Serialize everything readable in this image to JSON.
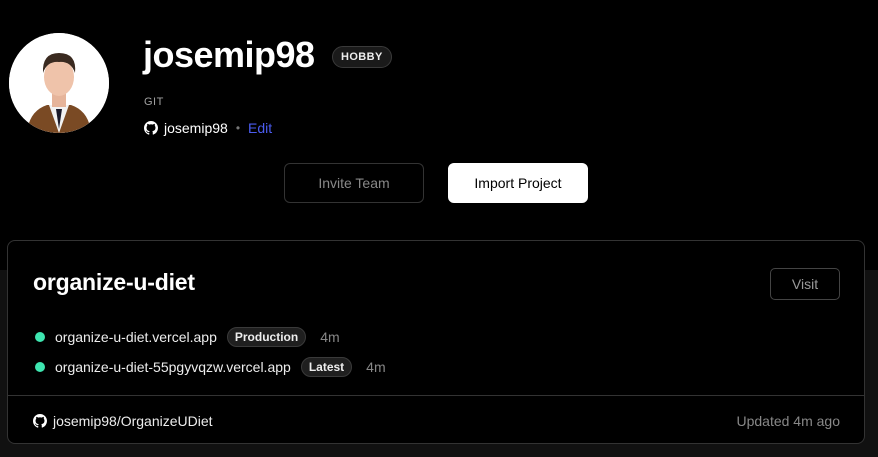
{
  "profile": {
    "username": "josemip98",
    "plan_badge": "HOBBY",
    "git_label": "GIT",
    "git_username": "josemip98",
    "separator": "•",
    "edit_label": "Edit"
  },
  "actions": {
    "invite_label": "Invite Team",
    "import_label": "Import Project"
  },
  "project": {
    "name": "organize-u-diet",
    "visit_label": "Visit",
    "deployments": [
      {
        "url": "organize-u-diet.vercel.app",
        "badge": "Production",
        "age": "4m",
        "status_color": "#3ee6b0"
      },
      {
        "url": "organize-u-diet-55pgyvqzw.vercel.app",
        "badge": "Latest",
        "age": "4m",
        "status_color": "#3ee6b0"
      }
    ],
    "repo": "josemip98/OrganizeUDiet",
    "updated": "Updated 4m ago"
  },
  "icons": {
    "github": "github-icon",
    "status": "status-dot-icon"
  },
  "colors": {
    "background": "#000000",
    "accent_link": "#4b5cf0",
    "status_ready": "#3ee6b0"
  }
}
